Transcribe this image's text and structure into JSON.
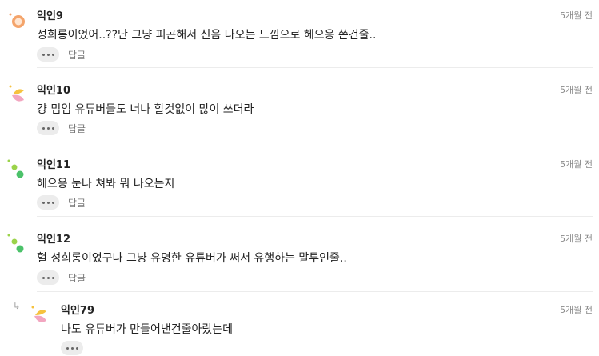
{
  "comments": [
    {
      "author": "익인9",
      "time": "5개월 전",
      "text": "성희롱이었어..??난 그냥 피곤해서 신음 나오는 느낌으로 헤으응 쓴건줄..",
      "reply_label": "답글"
    },
    {
      "author": "익인10",
      "time": "5개월 전",
      "text": "걍 밈임 유튜버들도 너나 할것없이 많이 쓰더라",
      "reply_label": "답글"
    },
    {
      "author": "익인11",
      "time": "5개월 전",
      "text": "헤으응 눈나 쳐봐 뭐 나오는지",
      "reply_label": "답글"
    },
    {
      "author": "익인12",
      "time": "5개월 전",
      "text": "헐 성희롱이었구나 그냥 유명한 유튜버가 써서 유행하는 말투인줄..",
      "reply_label": "답글"
    }
  ],
  "reply": {
    "author": "익인79",
    "time": "5개월 전",
    "text": "나도 유튜버가 만들어낸건줄아랐는데",
    "arrow": "↳"
  },
  "icons": {
    "more": "more-dots-icon",
    "reply_arrow": "reply-arrow-icon"
  },
  "colors": {
    "orange": "#f4a46b",
    "yellow": "#f6c23e",
    "pink": "#f2a6c0",
    "green": "#4cc26a",
    "lime": "#9bd34a"
  }
}
